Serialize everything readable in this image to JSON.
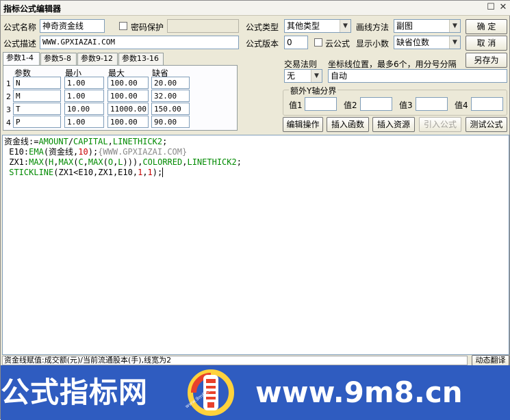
{
  "window": {
    "title": "指标公式编辑器"
  },
  "form": {
    "name_label": "公式名称",
    "name_value": "神奇资金线",
    "password_label": "密码保护",
    "desc_label": "公式描述",
    "desc_value": "WWW.GPXIAZAI.COM",
    "type_label": "公式类型",
    "type_value": "其他类型",
    "draw_label": "画线方法",
    "draw_value": "副图",
    "version_label": "公式版本",
    "version_value": "0",
    "cloud_label": "云公式",
    "decimal_label": "显示小数",
    "decimal_value": "缺省位数"
  },
  "buttons": {
    "ok": "确  定",
    "cancel": "取  消",
    "save_as": "另存为",
    "edit_ops": "编辑操作",
    "insert_func": "插入函数",
    "insert_res": "插入资源",
    "import_formula": "引入公式",
    "test_formula": "测试公式",
    "dynamic_translate": "动态翻译"
  },
  "tabs": [
    "参数1-4",
    "参数5-8",
    "参数9-12",
    "参数13-16"
  ],
  "params": {
    "headers": [
      "参数",
      "最小",
      "最大",
      "缺省"
    ],
    "rows": [
      {
        "idx": "1",
        "name": "N",
        "min": "1.00",
        "max": "100.00",
        "def": "20.00"
      },
      {
        "idx": "2",
        "name": "M",
        "min": "1.00",
        "max": "100.00",
        "def": "32.00"
      },
      {
        "idx": "3",
        "name": "T",
        "min": "10.00",
        "max": "11000.00",
        "def": "150.00"
      },
      {
        "idx": "4",
        "name": "P",
        "min": "1.00",
        "max": "100.00",
        "def": "90.00"
      }
    ]
  },
  "trade": {
    "rule_label": "交易法则",
    "rule_value": "无",
    "coord_label": "坐标线位置，最多6个，用分号分隔",
    "coord_value": "自动"
  },
  "yaxis": {
    "title": "额外Y轴分界",
    "v1": "值1",
    "v2": "值2",
    "v3": "值3",
    "v4": "值4"
  },
  "code": {
    "l1a": "资金线:=",
    "l1b": "AMOUNT",
    "l1c": "/",
    "l1d": "CAPITAL",
    "l1e": ",",
    "l1f": "LINETHICK2",
    "l1g": ";",
    "l2a": " E10:",
    "l2b": "EMA",
    "l2c": "(资金线,",
    "l2d": "10",
    "l2e": ");",
    "l2f": "{WWW.GPXIAZAI.COM}",
    "l3a": " ZX1:",
    "l3b": "MAX",
    "l3c": "(",
    "l3d": "H",
    "l3e": ",",
    "l3f": "MAX",
    "l3g": "(",
    "l3h": "C",
    "l3i": ",",
    "l3j": "MAX",
    "l3k": "(",
    "l3l": "O",
    "l3m": ",",
    "l3n": "L",
    "l3o": "))),",
    "l3p": "COLORRED",
    "l3q": ",",
    "l3r": "LINETHICK2",
    "l3s": ";",
    "l4a": " STICKLINE",
    "l4b": "(ZX1<E10,ZX1,E10,",
    "l4c": "1",
    "l4d": ",",
    "l4e": "1",
    "l4f": ");"
  },
  "status": {
    "text": "资金线赋值:成交额(元)/当前流通股本(手),线宽为2"
  },
  "banner": {
    "left_text": "公式指标网",
    "right_text": "www.9m8.cn",
    "logo_caption": "www.9m8.cn"
  },
  "colors": {
    "keyword": "#008a00",
    "number": "#c80000",
    "comment": "#8a8a8a",
    "banner_bg": "#2f5cc0"
  }
}
